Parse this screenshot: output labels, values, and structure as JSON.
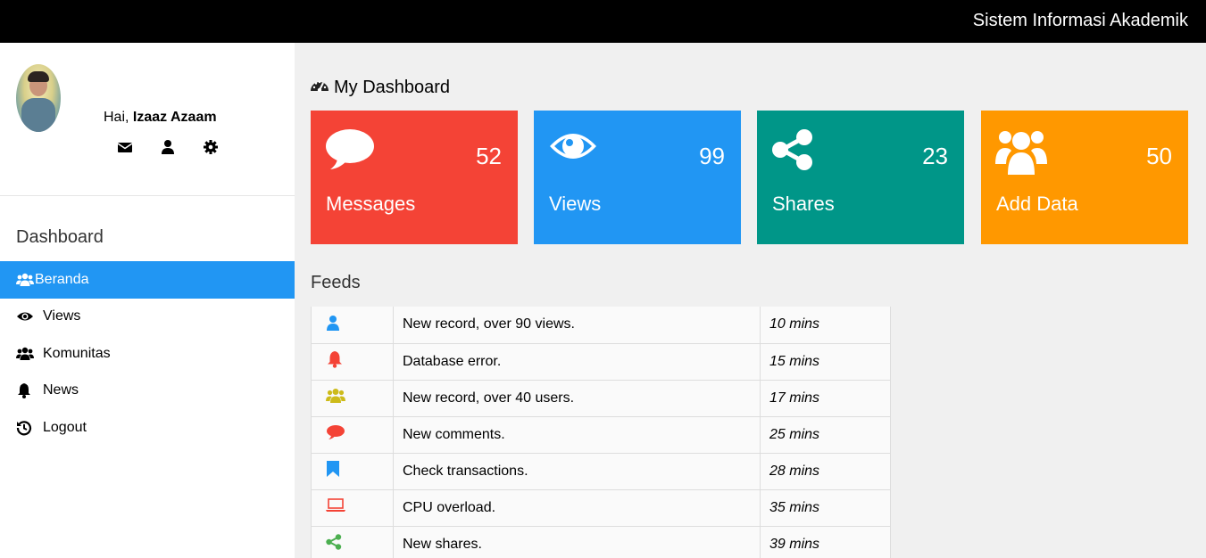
{
  "app": {
    "title": "Sistem Informasi Akademik"
  },
  "user": {
    "greeting": "Hai,",
    "name": "Izaaz Azaam"
  },
  "sidebar": {
    "heading": "Dashboard",
    "items": [
      {
        "label": "Beranda",
        "icon": "users-icon",
        "active": true
      },
      {
        "label": "Views",
        "icon": "eye-icon"
      },
      {
        "label": "Komunitas",
        "icon": "users-icon"
      },
      {
        "label": "News",
        "icon": "bell-icon"
      },
      {
        "label": "Logout",
        "icon": "history-icon"
      }
    ]
  },
  "dashboard": {
    "title": "My Dashboard",
    "cards": [
      {
        "label": "Messages",
        "value": "52",
        "color": "#f44336",
        "icon": "comment-icon"
      },
      {
        "label": "Views",
        "value": "99",
        "color": "#2196f3",
        "icon": "eye-icon"
      },
      {
        "label": "Shares",
        "value": "23",
        "color": "#009688",
        "icon": "share-icon"
      },
      {
        "label": "Add Data",
        "value": "50",
        "color": "#ff9800",
        "icon": "users-icon"
      }
    ]
  },
  "feeds": {
    "title": "Feeds",
    "rows": [
      {
        "icon": "user-icon",
        "color": "#2196f3",
        "text": "New record, over 90 views.",
        "time": "10 mins"
      },
      {
        "icon": "bell-icon",
        "color": "#f44336",
        "text": "Database error.",
        "time": "15 mins"
      },
      {
        "icon": "users-icon",
        "color": "#cdbb1a",
        "text": "New record, over 40 users.",
        "time": "17 mins"
      },
      {
        "icon": "comment-icon",
        "color": "#f44336",
        "text": "New comments.",
        "time": "25 mins"
      },
      {
        "icon": "bookmark-icon",
        "color": "#2196f3",
        "text": "Check transactions.",
        "time": "28 mins"
      },
      {
        "icon": "laptop-icon",
        "color": "#f44336",
        "text": "CPU overload.",
        "time": "35 mins"
      },
      {
        "icon": "share-icon",
        "color": "#4caf50",
        "text": "New shares.",
        "time": "39 mins"
      }
    ]
  }
}
